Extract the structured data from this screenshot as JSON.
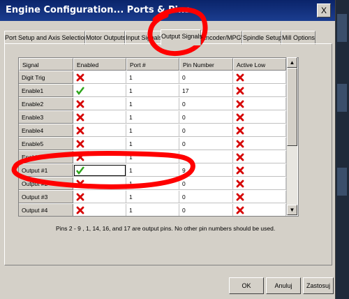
{
  "window": {
    "title": "Engine Configuration... Ports & Pins",
    "close_label": "X"
  },
  "tabs": [
    {
      "label": "Port Setup and Axis Selection",
      "active": false
    },
    {
      "label": "Motor Outputs",
      "active": false
    },
    {
      "label": "Input Signals",
      "active": false
    },
    {
      "label": "Output Signals",
      "active": true
    },
    {
      "label": "Encoder/MPG's",
      "active": false
    },
    {
      "label": "Spindle Setup",
      "active": false
    },
    {
      "label": "Mill Options",
      "active": false
    }
  ],
  "table": {
    "columns": [
      "Signal",
      "Enabled",
      "Port #",
      "Pin Number",
      "Active Low"
    ],
    "rows": [
      {
        "signal": "Digit  Trig",
        "enabled": "x",
        "port": "1",
        "pin": "0",
        "active_low": "x"
      },
      {
        "signal": "Enable1",
        "enabled": "check",
        "port": "1",
        "pin": "17",
        "active_low": "x"
      },
      {
        "signal": "Enable2",
        "enabled": "x",
        "port": "1",
        "pin": "0",
        "active_low": "x"
      },
      {
        "signal": "Enable3",
        "enabled": "x",
        "port": "1",
        "pin": "0",
        "active_low": "x"
      },
      {
        "signal": "Enable4",
        "enabled": "x",
        "port": "1",
        "pin": "0",
        "active_low": "x"
      },
      {
        "signal": "Enable5",
        "enabled": "x",
        "port": "1",
        "pin": "0",
        "active_low": "x"
      },
      {
        "signal": "Enable6",
        "enabled": "x",
        "port": "1",
        "pin": "0",
        "active_low": "x"
      },
      {
        "signal": "Output #1",
        "enabled": "check",
        "port": "1",
        "pin": "9",
        "active_low": "x"
      },
      {
        "signal": "Output #2",
        "enabled": "x",
        "port": "1",
        "pin": "0",
        "active_low": "x"
      },
      {
        "signal": "Output #3",
        "enabled": "x",
        "port": "1",
        "pin": "0",
        "active_low": "x"
      },
      {
        "signal": "Output #4",
        "enabled": "x",
        "port": "1",
        "pin": "0",
        "active_low": "x"
      }
    ]
  },
  "info_text": "Pins 2 - 9 , 1, 14, 16, and 17 are output pins. No  other pin numbers should be used.",
  "buttons": {
    "ok": "OK",
    "cancel": "Anuluj",
    "apply": "Zastosuj"
  },
  "icons": {
    "enabled_true": "green-check-icon",
    "enabled_false": "red-x-icon"
  },
  "colors": {
    "titlebar": "#0a246a",
    "face": "#d4d0c8",
    "annotation": "#ff0000",
    "check": "#2fa51c",
    "cross": "#d60000"
  }
}
